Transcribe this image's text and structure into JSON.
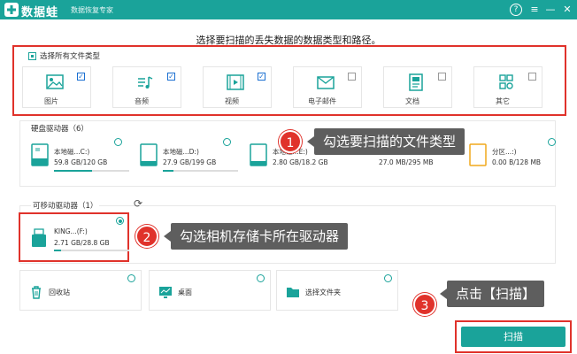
{
  "app": {
    "brand": "数据蛙",
    "slogan": "数据恢复专家",
    "title_buttons": {
      "help": "?",
      "menu": "≡",
      "minimize": "—",
      "close": "✕"
    }
  },
  "headline": "选择要扫描的丢失数据的数据类型和路径。",
  "file_types": {
    "select_all_label": "选择所有文件类型",
    "items": [
      {
        "label": "图片",
        "icon": "image-icon",
        "checked": true
      },
      {
        "label": "音频",
        "icon": "music-icon",
        "checked": true
      },
      {
        "label": "视频",
        "icon": "video-icon",
        "checked": true
      },
      {
        "label": "电子邮件",
        "icon": "mail-icon",
        "checked": false
      },
      {
        "label": "文档",
        "icon": "document-icon",
        "checked": false
      },
      {
        "label": "其它",
        "icon": "other-icon",
        "checked": false
      }
    ]
  },
  "hard_drives": {
    "title": "硬盘驱动器（6）",
    "items": [
      {
        "name": "本地磁...C:)",
        "size": "59.8 GB/120 GB",
        "used_fraction": 0.5
      },
      {
        "name": "本地磁...D:)",
        "size": "27.9 GB/199 GB",
        "used_fraction": 0.14
      },
      {
        "name": "本地磁...E:)",
        "size": "2.80 GB/18.2 GB",
        "used_fraction": 0.15
      },
      {
        "name": "本地磁...",
        "size": "27.0 MB/295 MB",
        "used_fraction": 0.09
      },
      {
        "name": "分区...:)",
        "size": "0.00 B/128 MB",
        "used_fraction": 0.0
      }
    ]
  },
  "removable": {
    "title": "可移动驱动器（1）",
    "refresh_icon": "refresh-icon",
    "items": [
      {
        "name": "KING...(F:)",
        "size": "2.71 GB/28.8 GB",
        "used_fraction": 0.09,
        "selected": true
      }
    ]
  },
  "locations": [
    {
      "label": "回收站",
      "icon": "recycle-bin-icon"
    },
    {
      "label": "桌面",
      "icon": "desktop-icon"
    },
    {
      "label": "选择文件夹",
      "icon": "folder-icon"
    }
  ],
  "callouts": [
    {
      "num": "1",
      "text": "勾选要扫描的文件类型"
    },
    {
      "num": "2",
      "text": "勾选相机存储卡所在驱动器"
    },
    {
      "num": "3",
      "text": "点击【扫描】"
    }
  ],
  "scan_button": "扫描",
  "colors": {
    "accent": "#1aa39a",
    "highlight": "#e0322b",
    "callout_bg": "#5e5e5e"
  }
}
